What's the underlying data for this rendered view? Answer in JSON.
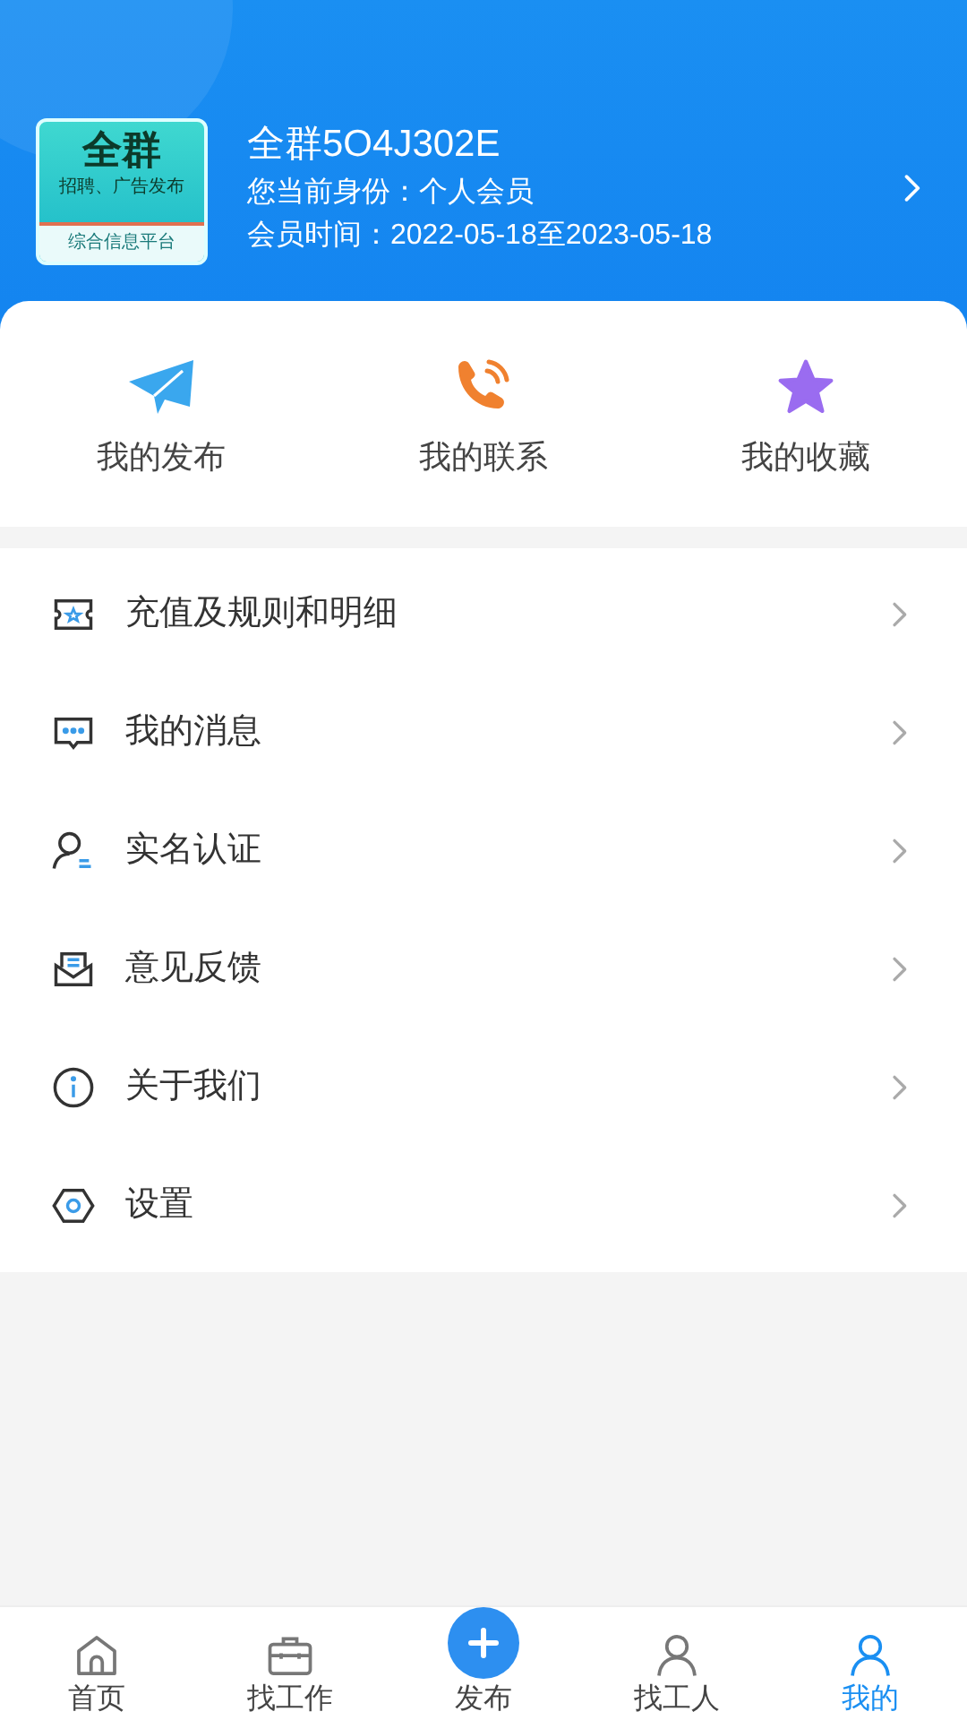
{
  "profile": {
    "logo": {
      "title": "全群",
      "subtitle": "招聘、广告发布",
      "footer": "综合信息平台"
    },
    "name": "全群5O4J302E",
    "identity": "您当前身份：个人会员",
    "membership": "会员时间：2022-05-18至2023-05-18"
  },
  "shortcuts": [
    {
      "kind": "plane",
      "label": "我的发布"
    },
    {
      "kind": "phone",
      "label": "我的联系"
    },
    {
      "kind": "star",
      "label": "我的收藏"
    }
  ],
  "menu": [
    {
      "kind": "ticket",
      "label": "充值及规则和明细"
    },
    {
      "kind": "message",
      "label": "我的消息"
    },
    {
      "kind": "user",
      "label": "实名认证"
    },
    {
      "kind": "mail",
      "label": "意见反馈"
    },
    {
      "kind": "info",
      "label": "关于我们"
    },
    {
      "kind": "settings",
      "label": "设置"
    }
  ],
  "tabbar": [
    {
      "kind": "home",
      "label": "首页",
      "selected": false
    },
    {
      "kind": "briefcase",
      "label": "找工作",
      "selected": false
    },
    {
      "kind": "publish",
      "label": "发布",
      "selected": false
    },
    {
      "kind": "worker",
      "label": "找工人",
      "selected": false
    },
    {
      "kind": "me",
      "label": "我的",
      "selected": true
    }
  ]
}
